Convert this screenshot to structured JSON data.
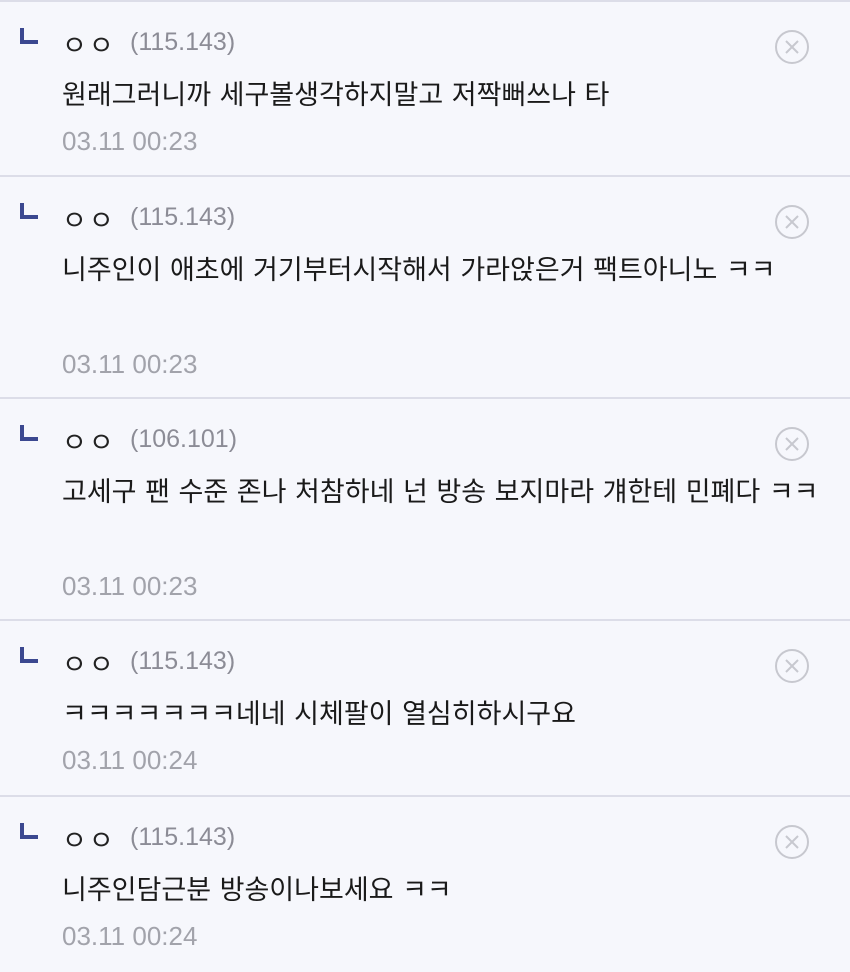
{
  "replies": [
    {
      "nickname": "ㅇㅇ",
      "ip": "(115.143)",
      "text": "원래그러니까 세구볼생각하지말고 저짝뻐쓰나 타",
      "date": "03.11 00:23"
    },
    {
      "nickname": "ㅇㅇ",
      "ip": "(115.143)",
      "text": "니주인이 애초에 거기부터시작해서 가라앉은거 팩트아니노 ㅋㅋ",
      "date": "03.11 00:23"
    },
    {
      "nickname": "ㅇㅇ",
      "ip": "(106.101)",
      "text": "고세구 팬 수준 존나 처참하네 넌 방송 보지마라 걔한테 민폐다 ㅋㅋ",
      "date": "03.11 00:23"
    },
    {
      "nickname": "ㅇㅇ",
      "ip": "(115.143)",
      "text": "ㅋㅋㅋㅋㅋㅋㅋ네네 시체팔이 열심히하시구요",
      "date": "03.11 00:24"
    },
    {
      "nickname": "ㅇㅇ",
      "ip": "(115.143)",
      "text": "니주인담근분 방송이나보세요 ㅋㅋ",
      "date": "03.11 00:24"
    }
  ],
  "colors": {
    "accent": "#3b4890",
    "background": "#f6f7fc",
    "divider": "#dcdde8",
    "muted": "#a2a3ab"
  },
  "icons": {
    "reply": "reply-arrow-icon",
    "delete": "circle-x-icon"
  }
}
